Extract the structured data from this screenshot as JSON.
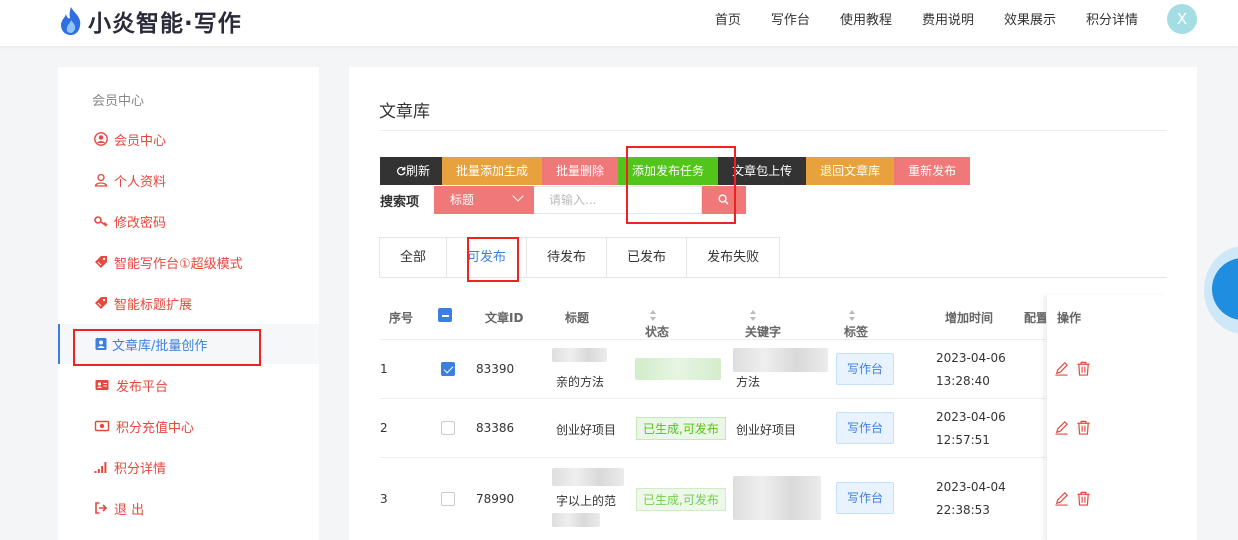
{
  "header": {
    "brand": "小炎智能·写作",
    "nav": [
      "首页",
      "写作台",
      "使用教程",
      "费用说明",
      "效果展示",
      "积分详情"
    ],
    "avatar_letter": "X"
  },
  "sidebar": {
    "section_title": "会员中心",
    "items": [
      {
        "label": "会员中心",
        "icon": "user-circle-icon"
      },
      {
        "label": "个人资料",
        "icon": "person-icon"
      },
      {
        "label": "修改密码",
        "icon": "key-icon"
      },
      {
        "label": "智能写作台①超级模式",
        "icon": "tag-icon"
      },
      {
        "label": "智能标题扩展",
        "icon": "tag-icon"
      },
      {
        "label": "文章库/批量创作",
        "icon": "contact-card-icon"
      },
      {
        "label": "发布平台",
        "icon": "id-card-icon"
      },
      {
        "label": "积分充值中心",
        "icon": "money-icon"
      },
      {
        "label": "积分详情",
        "icon": "signal-bars-icon"
      },
      {
        "label": "退 出",
        "icon": "logout-icon"
      }
    ],
    "active_index": 5
  },
  "main": {
    "title": "文章库",
    "toolbar": [
      {
        "label": "刷新",
        "style": "dark",
        "icon": "refresh-icon"
      },
      {
        "label": "批量添加生成",
        "style": "orange"
      },
      {
        "label": "批量删除",
        "style": "pink"
      },
      {
        "label": "添加发布任务",
        "style": "green"
      },
      {
        "label": "文章包上传",
        "style": "dark"
      },
      {
        "label": "退回文章库",
        "style": "orange"
      },
      {
        "label": "重新发布",
        "style": "pink"
      }
    ],
    "search": {
      "label": "搜索项",
      "field": "标题",
      "placeholder": "请输入..."
    },
    "tabs": [
      "全部",
      "可发布",
      "待发布",
      "已发布",
      "发布失败"
    ],
    "active_tab": 1,
    "columns": [
      "序号",
      "文章ID",
      "标题",
      "状态",
      "关键字",
      "标签",
      "增加时间",
      "配置",
      "操作"
    ],
    "rows": [
      {
        "index": "1",
        "checked": true,
        "id": "83390",
        "title": "亲的方法",
        "status": "",
        "keyword": "方法",
        "tag": "写作台",
        "date": "2023-04-06",
        "time": "13:28:40"
      },
      {
        "index": "2",
        "checked": false,
        "id": "83386",
        "title": "创业好项目",
        "status": "已生成,可发布",
        "keyword": "创业好项目",
        "tag": "写作台",
        "date": "2023-04-06",
        "time": "12:57:51"
      },
      {
        "index": "3",
        "checked": false,
        "id": "78990",
        "title": "字以上的范",
        "status": "已生成,可发布",
        "keyword": "",
        "tag": "写作台",
        "date": "2023-04-04",
        "time": "22:38:53"
      }
    ]
  },
  "colors": {
    "accent_blue": "#3b7fe1",
    "red": "#e8473e",
    "pink": "#f07878",
    "orange": "#e8a23d",
    "green": "#52c41a",
    "dark": "#333333"
  }
}
